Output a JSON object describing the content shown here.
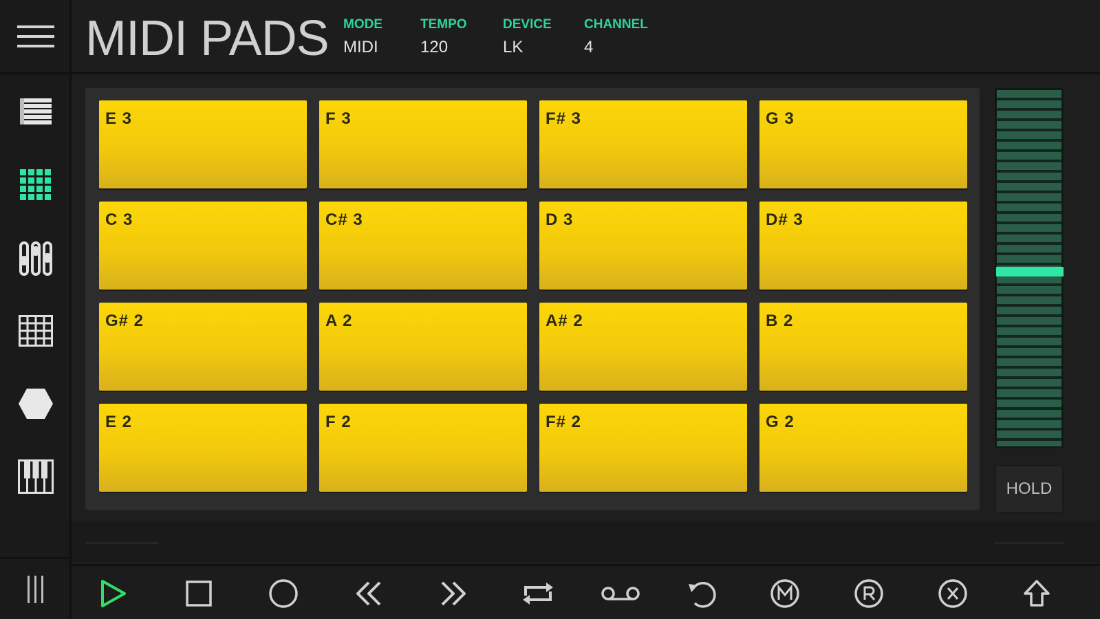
{
  "app": {
    "title": "MIDI PADS"
  },
  "header": {
    "info": [
      {
        "label": "MODE",
        "value": "MIDI"
      },
      {
        "label": "TEMPO",
        "value": "120"
      },
      {
        "label": "DEVICE",
        "value": "LK"
      },
      {
        "label": "CHANNEL",
        "value": "4"
      }
    ]
  },
  "sidebar": {
    "items": [
      {
        "icon": "list-icon",
        "active": false
      },
      {
        "icon": "pad-grid-icon",
        "active": true
      },
      {
        "icon": "mixer-icon",
        "active": false
      },
      {
        "icon": "step-grid-icon",
        "active": false
      },
      {
        "icon": "hexagon-icon",
        "active": false
      },
      {
        "icon": "keyboard-icon",
        "active": false
      }
    ]
  },
  "pads": {
    "rows": [
      [
        "E 3",
        "F 3",
        "F# 3",
        "G 3"
      ],
      [
        "C 3",
        "C# 3",
        "D 3",
        "D# 3"
      ],
      [
        "G# 2",
        "A 2",
        "A# 2",
        "B 2"
      ],
      [
        "E 2",
        "F 2",
        "F# 2",
        "G 2"
      ]
    ]
  },
  "slider": {
    "level": 0.49
  },
  "hold": {
    "label": "HOLD"
  },
  "transport": {
    "buttons": [
      "play-icon",
      "stop-icon",
      "record-icon",
      "rewind-icon",
      "fast-forward-icon",
      "loop-icon",
      "tape-icon",
      "undo-icon",
      "m-circle-icon",
      "r-circle-icon",
      "x-circle-icon",
      "shift-icon"
    ]
  },
  "colors": {
    "accent": "#2fd39b",
    "pad": "#f6cf0a",
    "background": "#1e1e1e"
  }
}
